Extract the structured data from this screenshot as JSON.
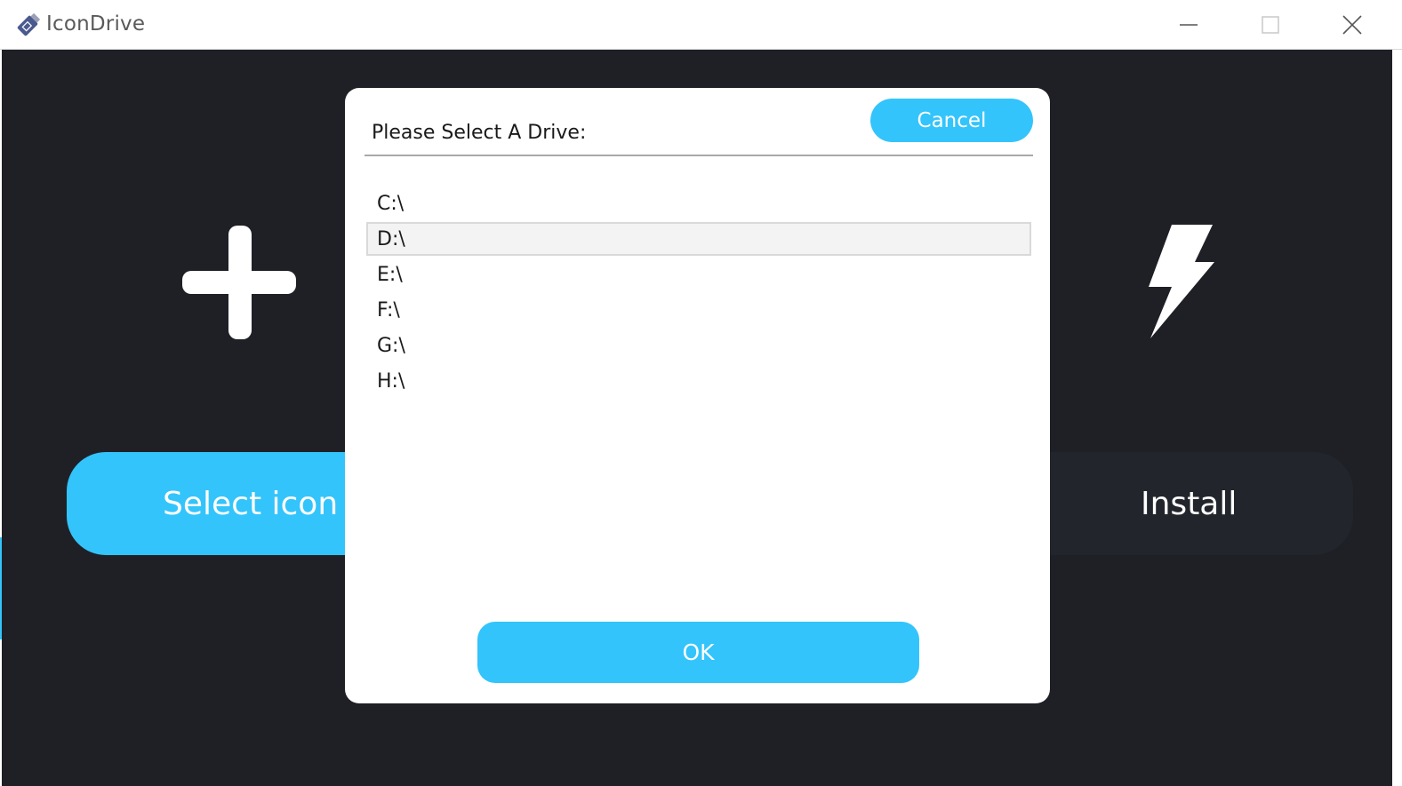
{
  "window": {
    "title": "IconDrive",
    "app_icon": "usb-drive-icon",
    "controls": [
      "minimize-icon",
      "maximize-icon",
      "close-icon"
    ]
  },
  "main": {
    "select_icon_button": "Select icon",
    "install_button": "Install",
    "left_icon": "plus-icon",
    "right_icon": "lightning-bolt-icon"
  },
  "dialog": {
    "title": "Please Select A Drive:",
    "cancel_label": "Cancel",
    "ok_label": "OK",
    "drives": [
      "C:\\",
      "D:\\",
      "E:\\",
      "F:\\",
      "G:\\",
      "H:\\"
    ],
    "selected_drive": "D:\\"
  },
  "colors": {
    "accent": "#33c4fb",
    "background": "#1f2026",
    "install_button": "#22252b",
    "dialog": "#ffffff"
  }
}
